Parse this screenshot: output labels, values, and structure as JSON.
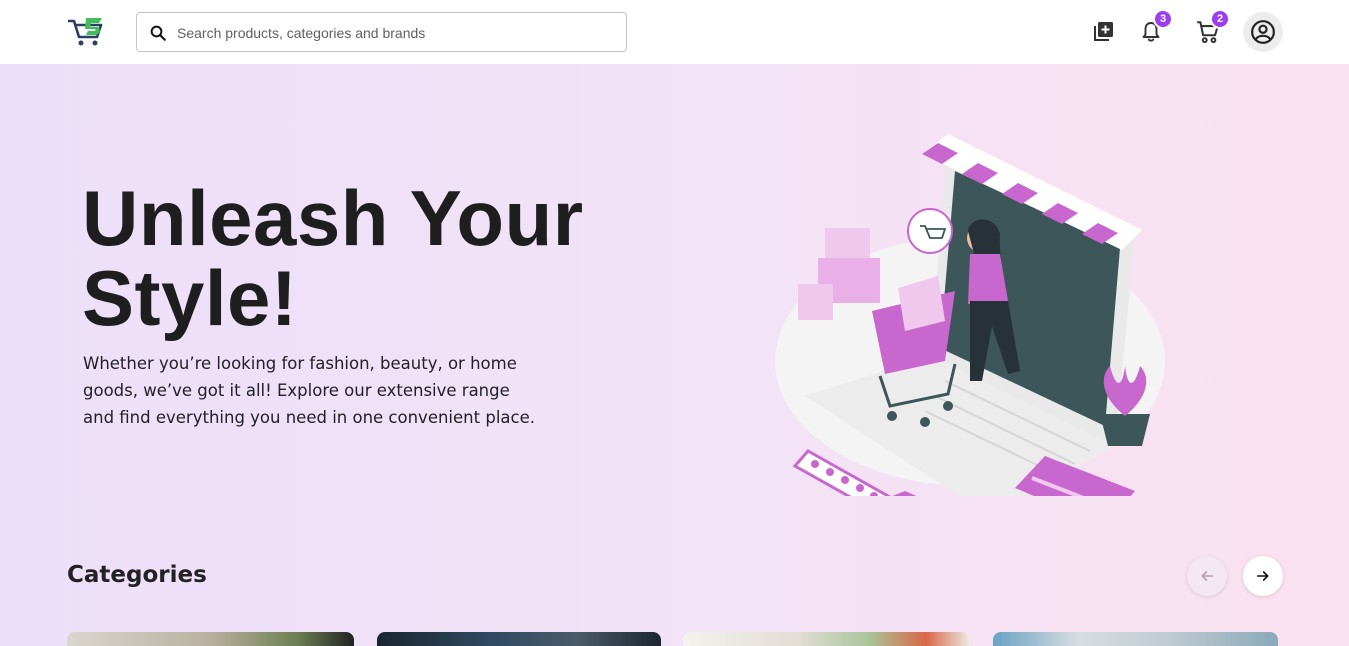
{
  "header": {
    "search_placeholder": "Search products, categories and brands",
    "notifications_count": "3",
    "cart_count": "2"
  },
  "hero": {
    "title_line1": "Unleash Your",
    "title_line2": "Style!",
    "subtitle": "Whether you’re looking for fashion, beauty, or home goods, we’ve got it all! Explore our extensive range and find everything you need in one convenient place."
  },
  "categories": {
    "title": "Categories"
  },
  "colors": {
    "accent": "#9b3ef0",
    "illustration_pink": "#c868cf",
    "illustration_dark": "#3d5659",
    "hero_bg_left": "#ecdff9",
    "hero_bg_right": "#fbe1ef"
  },
  "icons": {
    "logo": "cart-logo-icon",
    "search": "search-icon",
    "add_product": "add-box-icon",
    "notifications": "bell-icon",
    "cart": "cart-icon",
    "account": "account-circle-icon",
    "prev": "arrow-left-icon",
    "next": "arrow-right-icon"
  }
}
